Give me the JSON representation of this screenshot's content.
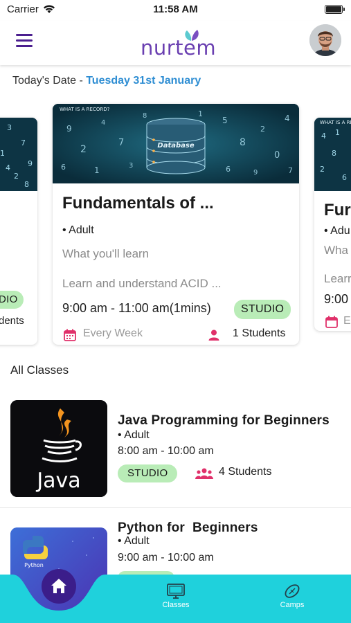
{
  "status_bar": {
    "carrier": "Carrier",
    "time": "11:58 AM"
  },
  "header": {
    "logo": "nurtem"
  },
  "today": {
    "label": "Today's Date - ",
    "date": "Tuesday 31st January"
  },
  "featured": {
    "image_caption": "WHAT IS A RECORD?",
    "image_badge": "Database",
    "title": "Fundamentals of ...",
    "level": "• Adult",
    "learn_heading": "What you'll learn",
    "learn_text": "Learn and understand ACID ...",
    "time": "9:00 am - 11:00 am(1mins)",
    "chip": "STUDIO",
    "frequency": "Every Week",
    "students": "1 Students"
  },
  "left_card": {
    "chip": "DIO",
    "students": "dents"
  },
  "right_card": {
    "title": "Fur",
    "level": "• Adu",
    "learn_heading": "Wha",
    "learn_text": "Learr",
    "time": "9:00",
    "frequency": "E"
  },
  "all_classes": {
    "title": "All Classes",
    "items": [
      {
        "title": "Java Programming for Beginners",
        "level": "• Adult",
        "time": "8:00 am - 10:00 am",
        "chip": "STUDIO",
        "students": "4 Students",
        "thumb_text": "Java"
      },
      {
        "title": "Python for  Beginners",
        "level": "• Adult",
        "time": "9:00 am - 10:00 am",
        "thumb_text": "Python"
      }
    ]
  },
  "tabs": {
    "classes": "Classes",
    "camps": "Camps"
  },
  "colors": {
    "brand_purple": "#4b1f8f",
    "accent_blue": "#2f8ed3",
    "chip_green": "#b9ecb7",
    "tab_teal": "#1fd1dc",
    "calendar_pink": "#e0306a"
  }
}
